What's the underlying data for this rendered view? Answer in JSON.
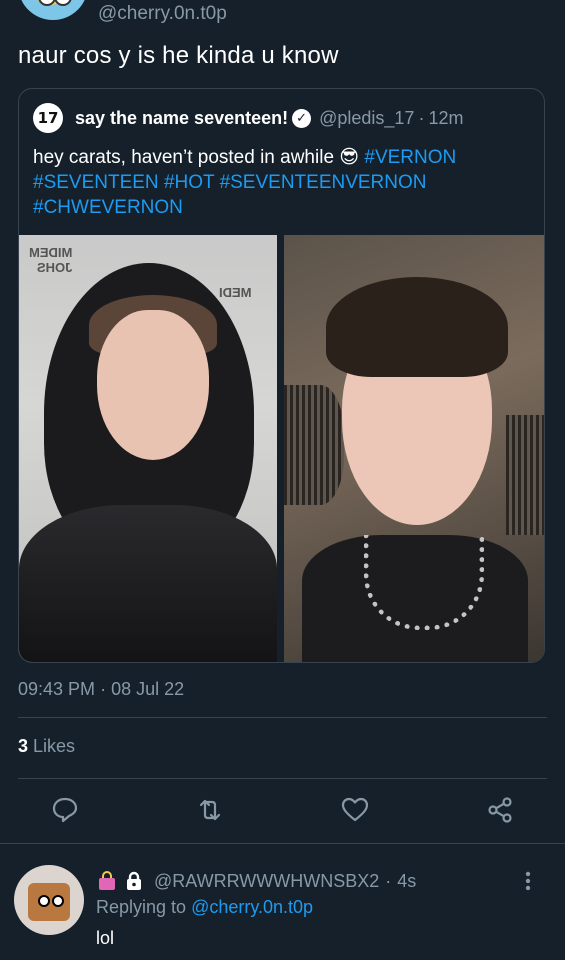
{
  "author": {
    "handle": "@cherry.0n.t0p"
  },
  "tweet": {
    "text": "naur cos y is he kinda u know"
  },
  "quote": {
    "avatar_text": "17",
    "name": "say the name seventeen!",
    "handle": "@pledis_17",
    "separator": "·",
    "time": "12m",
    "text_plain": "hey carats, haven’t posted in awhile 😎 ",
    "hashtags": [
      "#VERNON",
      "#SEVENTEEN",
      "#HOT",
      "#SEVENTEENVERNON",
      "#CHWEVERNON"
    ]
  },
  "meta": {
    "time": "09:43 PM",
    "separator": "·",
    "date": "08 Jul 22"
  },
  "likes": {
    "count": "3",
    "label": "Likes"
  },
  "icons": {
    "reply": "reply-icon",
    "retweet": "retweet-icon",
    "like": "heart-icon",
    "share": "share-icon"
  },
  "reply": {
    "badge_icons": [
      "shopping-bag-icon",
      "lock-icon"
    ],
    "handle": "@RAWRRWWWHWNSBX2",
    "separator": "·",
    "time": "4s",
    "replying_prefix": "Replying to",
    "replying_to": "@cherry.0n.t0p",
    "text": "lol"
  },
  "colors": {
    "background": "#15202b",
    "accent": "#1d9bf0",
    "muted": "#8899a6",
    "border": "#38444d"
  }
}
